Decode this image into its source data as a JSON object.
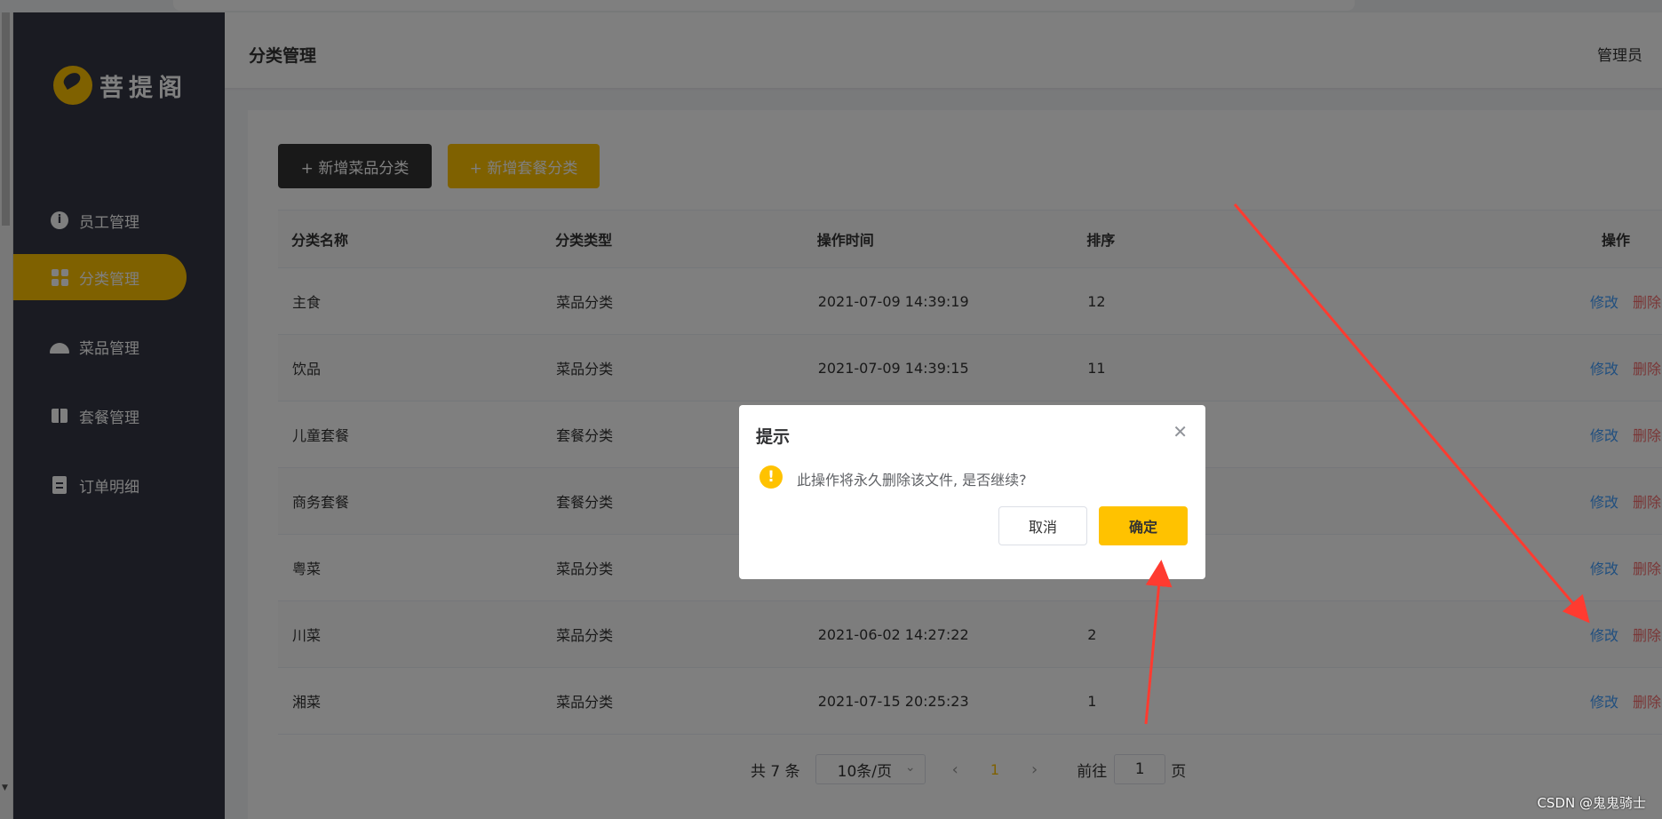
{
  "sidebar": {
    "logo_text": "菩提阁",
    "items": [
      {
        "label": "员工管理",
        "icon": "info-icon"
      },
      {
        "label": "分类管理",
        "icon": "grid-icon"
      },
      {
        "label": "菜品管理",
        "icon": "cloche-icon"
      },
      {
        "label": "套餐管理",
        "icon": "gift-icon"
      },
      {
        "label": "订单明细",
        "icon": "clipboard-icon"
      }
    ],
    "active_index": 1
  },
  "header": {
    "title": "分类管理",
    "user": "管理员"
  },
  "toolbar": {
    "add_dish_category": "+ 新增菜品分类",
    "add_combo_category": "+ 新增套餐分类"
  },
  "table": {
    "columns": [
      "分类名称",
      "分类类型",
      "操作时间",
      "排序",
      "操作"
    ],
    "rows": [
      {
        "name": "主食",
        "type": "菜品分类",
        "time": "2021-07-09 14:39:19",
        "sort": "12"
      },
      {
        "name": "饮品",
        "type": "菜品分类",
        "time": "2021-07-09 14:39:15",
        "sort": "11"
      },
      {
        "name": "儿童套餐",
        "type": "套餐分类",
        "time": "",
        "sort": ""
      },
      {
        "name": "商务套餐",
        "type": "套餐分类",
        "time": "",
        "sort": ""
      },
      {
        "name": "粤菜",
        "type": "菜品分类",
        "time": "",
        "sort": ""
      },
      {
        "name": "川菜",
        "type": "菜品分类",
        "time": "2021-06-02 14:27:22",
        "sort": "2"
      },
      {
        "name": "湘菜",
        "type": "菜品分类",
        "time": "2021-07-15 20:25:23",
        "sort": "1"
      }
    ],
    "edit_label": "修改",
    "delete_label": "删除"
  },
  "pagination": {
    "total": "共 7 条",
    "page_size": "10条/页",
    "current_page": "1",
    "goto_label": "前往",
    "goto_value": "1",
    "page_word": "页"
  },
  "dialog": {
    "title": "提示",
    "message": "此操作将永久删除该文件, 是否继续?",
    "cancel": "取消",
    "confirm": "确定"
  },
  "watermark": "CSDN @鬼鬼骑士",
  "colors": {
    "brand": "#ffc200",
    "sidebar": "#343744",
    "edit_link": "#419eff",
    "delete_link": "#f56c6c",
    "annotation_arrow": "#ff3b30"
  }
}
